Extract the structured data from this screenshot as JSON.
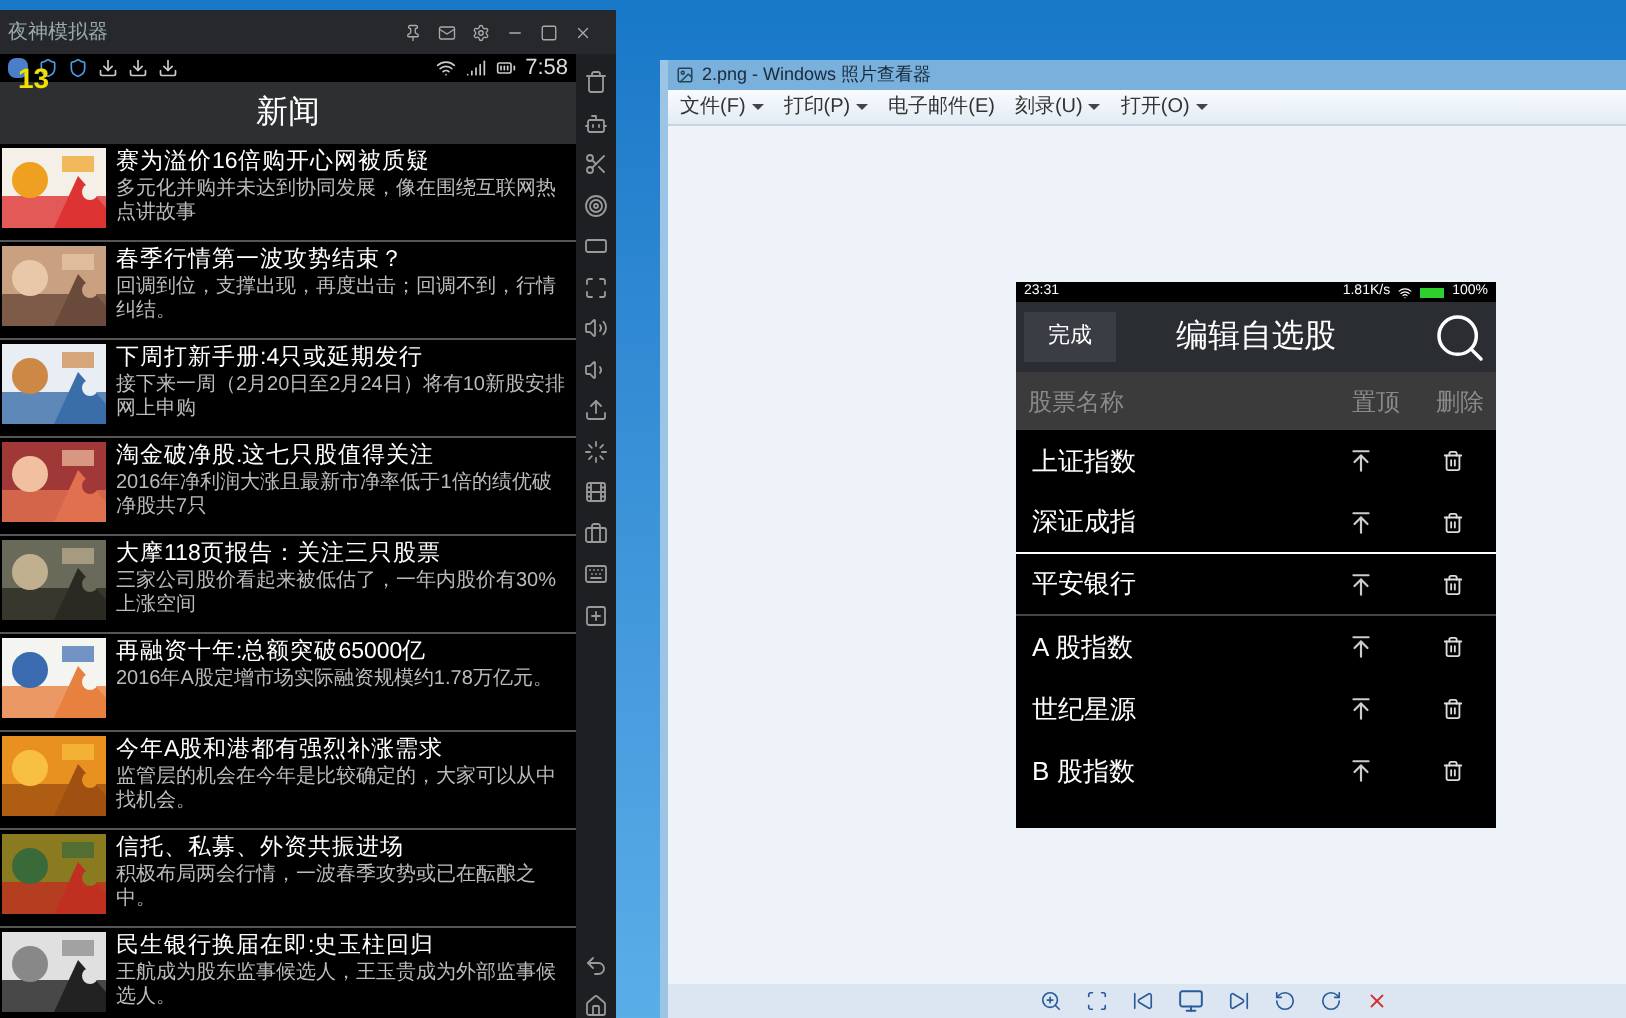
{
  "emulator": {
    "title": "夜神模拟器",
    "badge": "13",
    "time": "7:58",
    "header": "新闻",
    "news": [
      {
        "title": "赛为溢价16倍购开心网被质疑",
        "summary": "多元化并购并未达到协同发展，像在围绕互联网热点讲故事"
      },
      {
        "title": "春季行情第一波攻势结束？",
        "summary": "回调到位，支撑出现，再度出击；回调不到，行情纠结。"
      },
      {
        "title": "下周打新手册:4只或延期发行",
        "summary": "接下来一周（2月20日至2月24日）将有10新股安排网上申购"
      },
      {
        "title": "淘金破净股.这七只股值得关注",
        "summary": "2016年净利润大涨且最新市净率低于1倍的绩优破净股共7只"
      },
      {
        "title": "大摩118页报告：关注三只股票",
        "summary": "三家公司股价看起来被低估了，一年内股价有30%上涨空间"
      },
      {
        "title": "再融资十年:总额突破65000亿",
        "summary": "2016年A股定增市场实际融资规模约1.78万亿元。"
      },
      {
        "title": "今年A股和港都有强烈补涨需求",
        "summary": "监管层的机会在今年是比较确定的，大家可以从中找机会。"
      },
      {
        "title": "信托、私募、外资共振进场",
        "summary": "积极布局两会行情，一波春季攻势或已在酝酿之中。"
      },
      {
        "title": "民生银行换届在即:史玉柱回归",
        "summary": "王航成为股东监事候选人，王玉贵成为外部监事候选人。"
      }
    ]
  },
  "viewer": {
    "title": "2.png - Windows 照片查看器",
    "menu": [
      {
        "label": "文件(F)",
        "dropdown": true
      },
      {
        "label": "打印(P)",
        "dropdown": true
      },
      {
        "label": "电子邮件(E)",
        "dropdown": false
      },
      {
        "label": "刻录(U)",
        "dropdown": true
      },
      {
        "label": "打开(O)",
        "dropdown": true
      }
    ],
    "phone": {
      "time": "23:31",
      "speed": "1.81K/s",
      "battery": "100%",
      "done": "完成",
      "title": "编辑自选股",
      "columns": [
        "股票名称",
        "置顶",
        "删除"
      ],
      "stocks": [
        "上证指数",
        "深证成指",
        "平安银行",
        "A 股指数",
        "世纪星源",
        "B 股指数"
      ]
    }
  }
}
